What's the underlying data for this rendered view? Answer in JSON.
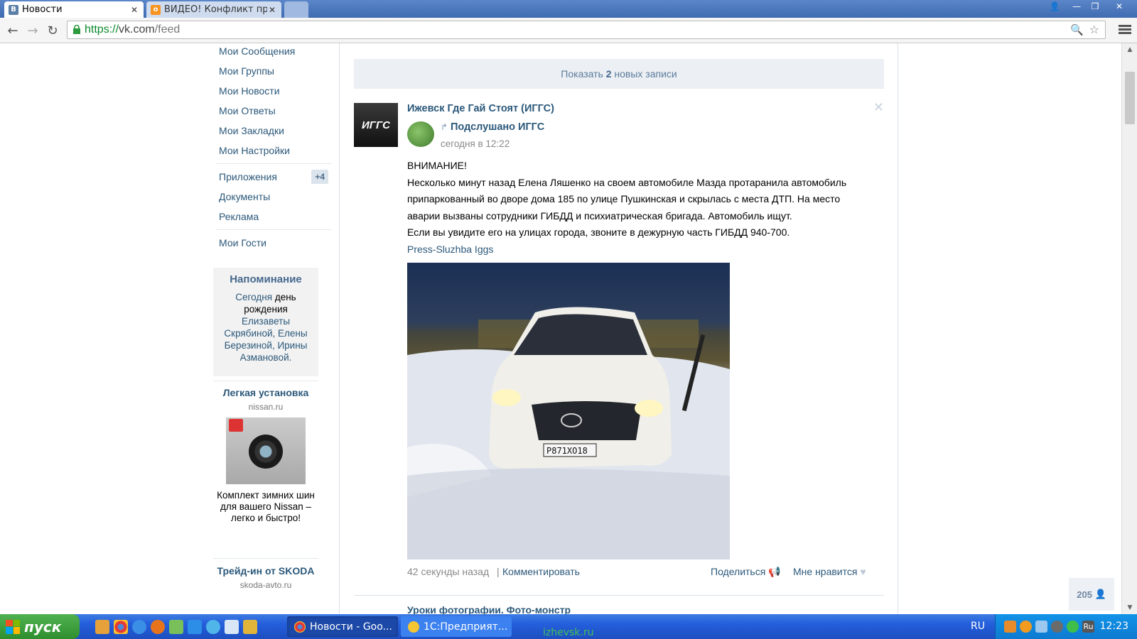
{
  "browser": {
    "tabs": [
      {
        "title": "Новости",
        "active": true
      },
      {
        "title": "ВИДЕО! Конфликт пр",
        "active": false
      }
    ],
    "url_scheme": "https://",
    "url_host": "vk.com",
    "url_path": "/feed"
  },
  "left_menu": {
    "items": [
      "Мои Сообщения",
      "Мои Группы",
      "Мои Новости",
      "Мои Ответы",
      "Мои Закладки",
      "Мои Настройки"
    ],
    "items2": [
      "Приложения",
      "Документы",
      "Реклама"
    ],
    "apps_badge": "+4",
    "guests": "Мои Гости"
  },
  "reminder": {
    "title": "Напоминание",
    "today": "Сегодня",
    "birthday": "день рождения",
    "names": "Елизаветы Скрябиной, Елены Березиной, Ирины Азмановой."
  },
  "ads": [
    {
      "title": "Легкая установка",
      "domain": "nissan.ru",
      "text": "Комплект зимних шин для вашего Nissan – легко и быстро!"
    },
    {
      "title": "Трейд-ин от SKODA",
      "domain": "skoda-avto.ru"
    }
  ],
  "feed": {
    "new_posts_prefix": "Показать",
    "new_posts_count": "2",
    "new_posts_suffix": "новых записи",
    "post": {
      "avatar_text": "ИГГС",
      "author": "Ижевск Где Гай Стоят (ИГГС)",
      "repost_from": "Подслушано ИГГС",
      "time": "сегодня в 12:22",
      "text_lines": [
        "ВНИМАНИЕ!",
        "Несколько минут назад Елена Ляшенко на своем автомобиле Мазда протаранила автомобиль",
        "припаркованный во дворе дома 185 по улице Пушкинская и скрылась с места ДТП. На место",
        "аварии вызваны сотрудники ГИБДД и психиатрическая бригада. Автомобиль ищут.",
        "Если вы увидите его на улицах города, звоните в дежурную часть ГИБДД 940-700."
      ],
      "signature": "Press-Sluzhba Iggs",
      "plate": "Р871ХО18",
      "ago": "42 секунды назад",
      "separator": "|",
      "comment": "Комментировать",
      "share": "Поделиться",
      "like": "Мне нравится"
    },
    "next_post_title": "Уроки фотографии. Фото-монстр",
    "online_count": "205"
  },
  "taskbar": {
    "start_label": "пуск",
    "tasks": [
      "Новости - Goo...",
      "1С:Предприят..."
    ],
    "watermark": "izhevsk.ru",
    "lang": "RU",
    "tray_lang": "Ru",
    "clock": "12:23"
  },
  "colors": {
    "vk_link": "#2b587a",
    "vk_header": "#45688e",
    "taskbar": "#245edb"
  }
}
